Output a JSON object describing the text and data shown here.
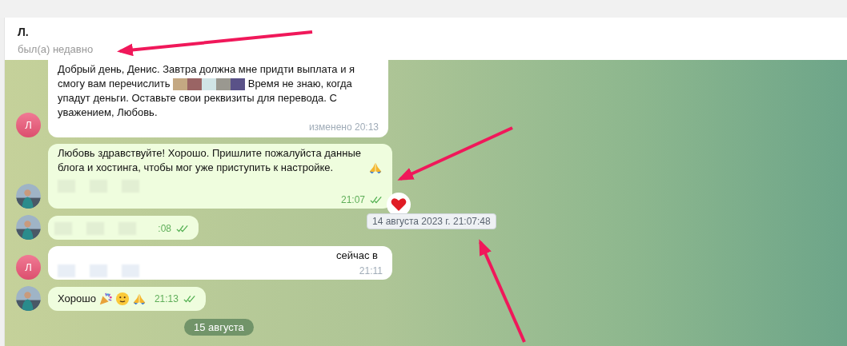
{
  "header": {
    "name": "Л.",
    "status": "был(а) недавно"
  },
  "messages": [
    {
      "kind": "incoming",
      "avatar": "Л",
      "text_before": "Добрый день, Денис. Завтра должна мне придти выплата и я смогу вам перечислить",
      "text_after": "Время не знаю, когда упадут деньги. Оставьте свои реквизиты для перевода. С уважением, Любовь.",
      "time": "изменено 20:13"
    },
    {
      "kind": "outgoing",
      "text": "Любовь здравствуйте! Хорошо. Пришлите пожалуйста данные блога и хостинга, чтобы мог уже приступить к настройке.",
      "pray_emoji": true,
      "blurred": true,
      "time": "21:07",
      "read": true,
      "reacted": true,
      "tooltip": "14 августа 2023 г. 21:07:48"
    },
    {
      "kind": "outgoing",
      "blurred": true,
      "time": ":08",
      "read": true
    },
    {
      "kind": "incoming",
      "avatar": "Л",
      "text": "сейчас в",
      "blurred": true,
      "time": "21:11"
    },
    {
      "kind": "outgoing",
      "text": "Хорошо",
      "party_emoji": true,
      "smile_emoji": true,
      "pray_emoji": true,
      "time": "21:13",
      "read": true
    }
  ],
  "date_pill": "15 августа"
}
